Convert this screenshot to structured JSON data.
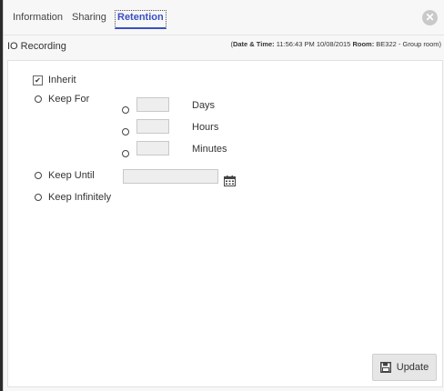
{
  "tabs": [
    {
      "label": "Information",
      "active": false
    },
    {
      "label": "Sharing",
      "active": false
    },
    {
      "label": "Retention",
      "active": true
    }
  ],
  "close_icon": "close-icon",
  "header": {
    "title": "IO Recording",
    "date_time_label": "Date & Time:",
    "date_time_value": "11:56:43 PM 10/08/2015",
    "room_label": "Room:",
    "room_value": "BE322 - Group room"
  },
  "retention": {
    "inherit": {
      "label": "Inherit",
      "checked": true
    },
    "keep_for": {
      "label": "Keep For",
      "days": {
        "unit": "Days",
        "value": ""
      },
      "hours": {
        "unit": "Hours",
        "value": ""
      },
      "minutes": {
        "unit": "Minutes",
        "value": ""
      }
    },
    "keep_until": {
      "label": "Keep Until",
      "value": "",
      "icon": "calendar-icon"
    },
    "keep_infinitely": {
      "label": "Keep Infinitely"
    }
  },
  "update_button": {
    "label": "Update",
    "icon": "save-icon"
  },
  "colors": {
    "active_tab": "#3a4fc4",
    "input_bg": "#eeeeee"
  }
}
